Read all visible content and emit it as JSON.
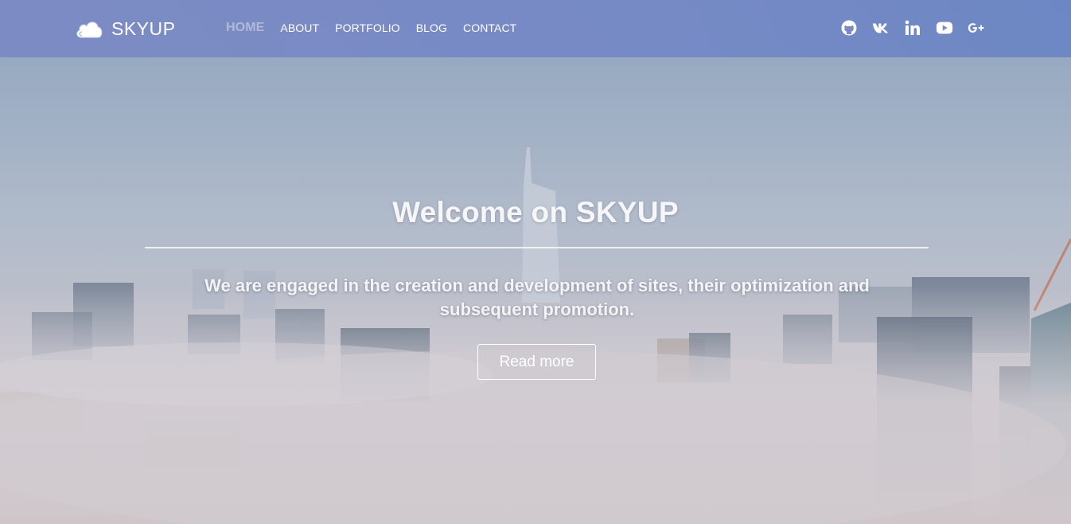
{
  "brand": {
    "name": "SKYUP",
    "logo_icon": "cloud-icon"
  },
  "nav": {
    "items": [
      {
        "label": "HOME",
        "active": true
      },
      {
        "label": "ABOUT",
        "active": false
      },
      {
        "label": "PORTFOLIO",
        "active": false
      },
      {
        "label": "BLOG",
        "active": false
      },
      {
        "label": "CONTACT",
        "active": false
      }
    ]
  },
  "social": [
    {
      "icon": "github-icon"
    },
    {
      "icon": "vk-icon"
    },
    {
      "icon": "linkedin-icon"
    },
    {
      "icon": "youtube-icon"
    },
    {
      "icon": "google-plus-icon"
    }
  ],
  "hero": {
    "title": "Welcome on SKYUP",
    "subtitle": "We are engaged in the creation and development of sites, their optimization and subsequent promotion.",
    "button_label": "Read more",
    "background": "foggy-city-skyline-image"
  },
  "colors": {
    "navbar": "#7888c4",
    "active_nav": "#b0b9d8",
    "text": "#ffffff"
  }
}
